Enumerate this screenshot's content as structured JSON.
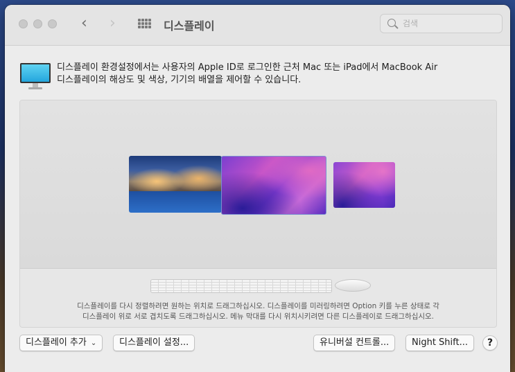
{
  "window": {
    "title": "디스플레이",
    "nav": {
      "back_glyph": "‹",
      "forward_glyph": "›"
    },
    "search": {
      "placeholder": "검색",
      "value": ""
    }
  },
  "intro": {
    "text_line1": "디스플레이 환경설정에서는 사용자의 Apple ID로 로그인한 근처 Mac 또는 iPad에서 MacBook Air",
    "text_line2": "디스플레이의 해상도 및 색상, 기기의 배열을 제어할 수 있습니다.",
    "icon": "monitor-icon"
  },
  "arrangement": {
    "displays": [
      {
        "label": "display-1",
        "wallpaper": "night-city-buildings"
      },
      {
        "label": "display-2",
        "wallpaper": "monterey-purple",
        "selected": true
      },
      {
        "label": "display-3",
        "wallpaper": "monterey-purple"
      }
    ],
    "hint_line1": "디스플레이를 다시 정렬하려면 원하는 위치로 드래그하십시오. 디스플레이를 미러링하려면 Option 키를 누른 상태로 각",
    "hint_line2": "디스플레이 위로 서로 겹치도록 드래그하십시오. 메뉴 막대를 다시 위치시키려면 다른 디스플레이로 드래그하십시오."
  },
  "buttons": {
    "add_display": "디스플레이 추가",
    "display_settings": "디스플레이 설정...",
    "universal_control": "유니버설 컨트롤...",
    "night_shift": "Night Shift...",
    "help": "?"
  },
  "colors": {
    "accent_monitor": "#24a6dd",
    "window_bg": "#ececec",
    "wallpaper_purple": "#c452c8"
  }
}
